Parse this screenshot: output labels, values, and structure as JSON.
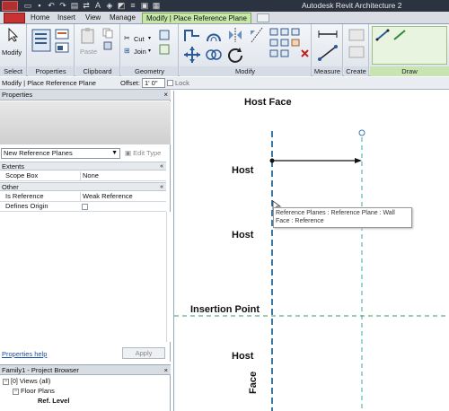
{
  "title_bar": {
    "app_title": "Autodesk Revit Architecture 2"
  },
  "ribbon_tabs": [
    {
      "label": "Home"
    },
    {
      "label": "Insert"
    },
    {
      "label": "View"
    },
    {
      "label": "Manage"
    },
    {
      "label": "Modify | Place Reference Plane"
    }
  ],
  "ribbon": {
    "modify_label": "Modify",
    "paste_label": "Paste",
    "cut_label": "Cut",
    "join_label": "Join",
    "panels": {
      "select": "Select",
      "properties": "Properties",
      "clipboard": "Clipboard",
      "geometry": "Geometry",
      "modify": "Modify",
      "measure": "Measure",
      "create": "Create",
      "draw": "Draw"
    }
  },
  "options_bar": {
    "context": "Modify | Place Reference Plane",
    "offset_label": "Offset:",
    "offset_value": "1' 0\"",
    "lock_label": "Lock"
  },
  "properties": {
    "header": "Properties",
    "type": "New Reference Planes",
    "edit_type": "Edit Type",
    "groups": [
      {
        "name": "Extents",
        "rows": [
          {
            "key": "Scope Box",
            "value": "None"
          }
        ]
      },
      {
        "name": "Other",
        "rows": [
          {
            "key": "Is Reference",
            "value": "Weak Reference"
          },
          {
            "key": "Defines Origin",
            "value": ""
          }
        ]
      }
    ],
    "help": "Properties help",
    "apply": "Apply"
  },
  "project_browser": {
    "header": "Family1 - Project Browser",
    "items": [
      {
        "label": "Views (all)"
      },
      {
        "label": "Floor Plans"
      },
      {
        "label": "Ref. Level"
      }
    ]
  },
  "canvas": {
    "labels": {
      "host_face": "Host Face",
      "host_1": "Host",
      "host_2": "Host",
      "insertion_point": "Insertion Point",
      "host_3": "Host",
      "face": "Face"
    },
    "tooltip": "Reference Planes : Reference Plane : Wall Face : Reference",
    "colors": {
      "reference_plane": "#3a78a8",
      "horizontal_plane": "#3a9a58"
    }
  }
}
